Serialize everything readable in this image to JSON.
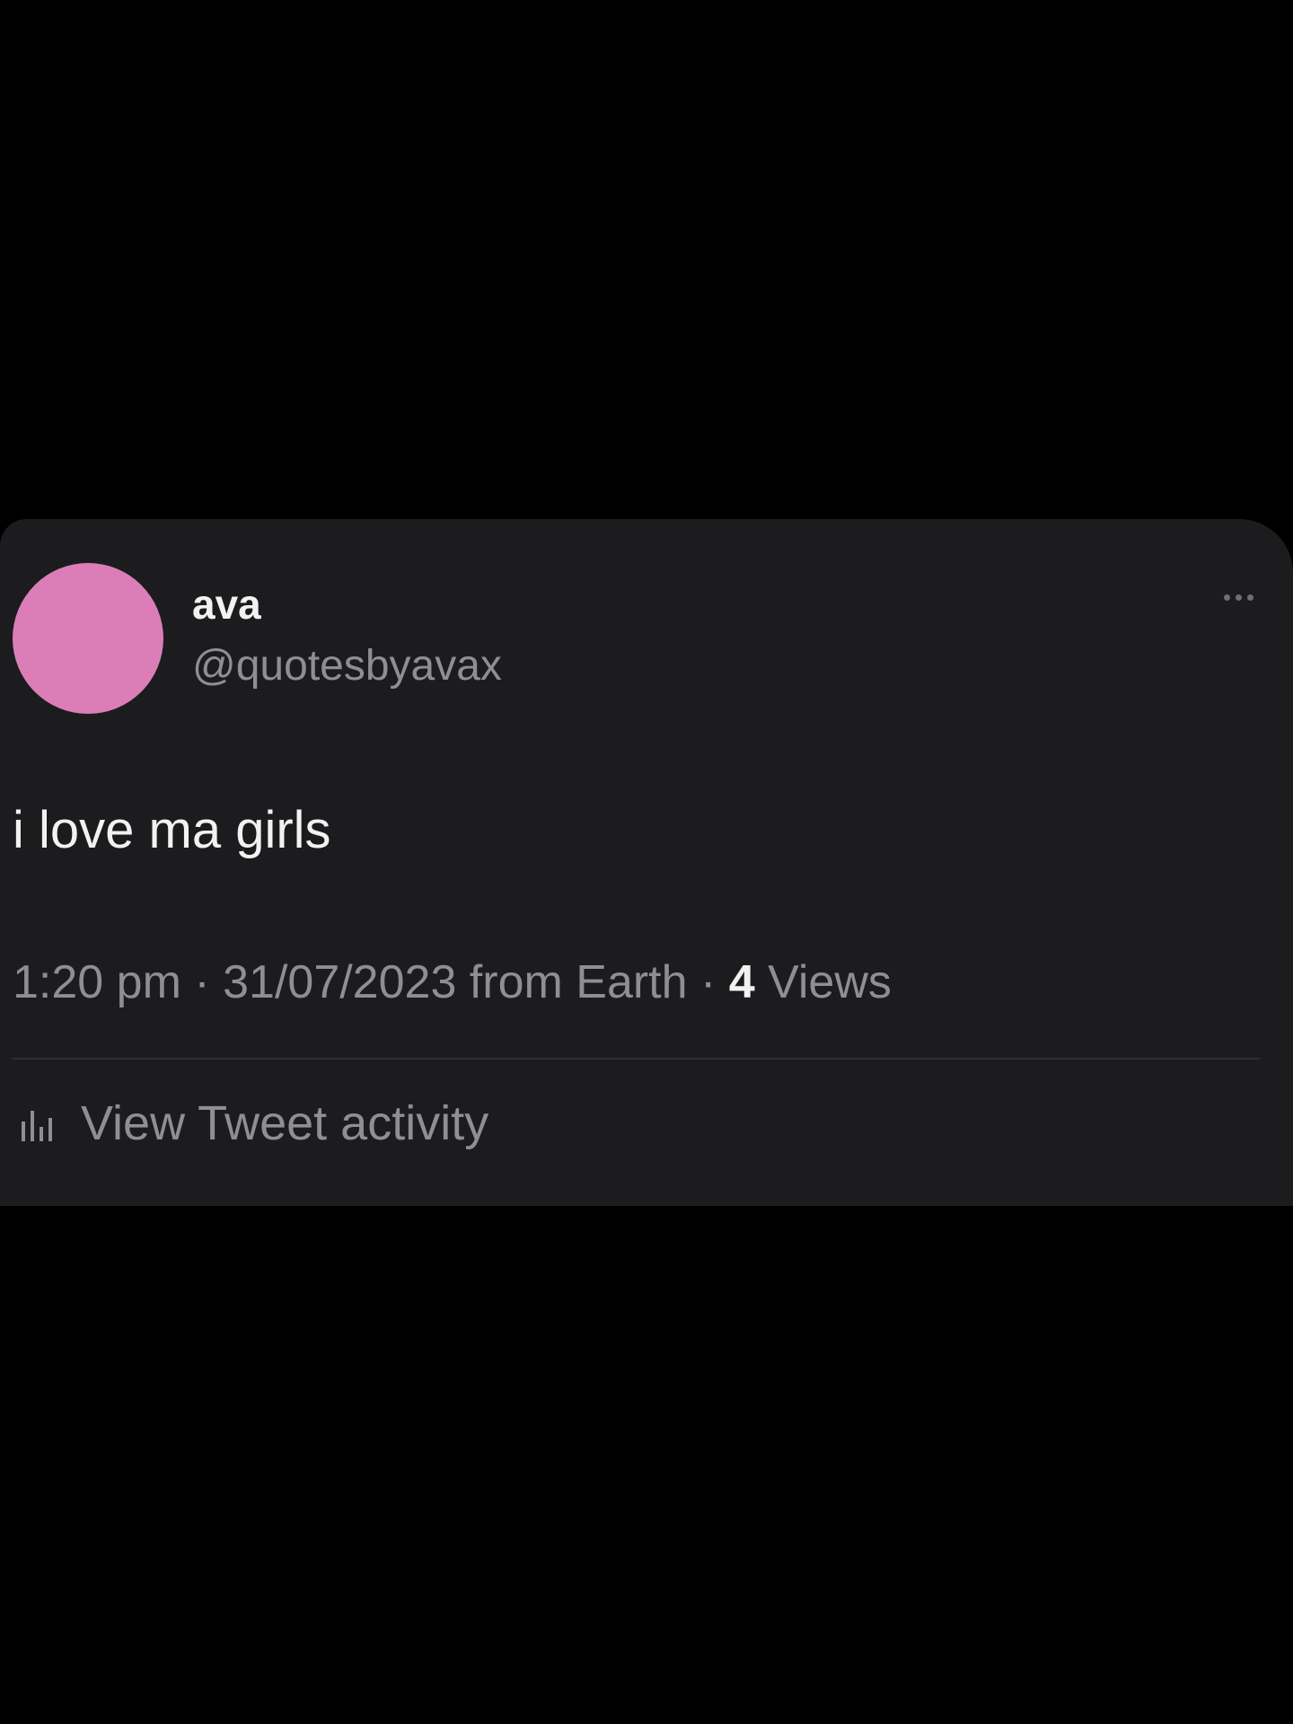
{
  "tweet": {
    "author": {
      "display_name": "ava",
      "handle": "@quotesbyavax",
      "avatar_color": "#db7eb8"
    },
    "more_icon": "more-options-icon",
    "text": "i love ma girls",
    "meta": {
      "time": "1:20 pm",
      "separator1": " · ",
      "date_source": "31/07/2023 from Earth",
      "separator2": " · ",
      "views_count": "4",
      "views_label": " Views"
    },
    "activity": {
      "icon": "bar-chart-icon",
      "label": "View Tweet activity"
    }
  },
  "colors": {
    "background": "#000000",
    "card": "#1c1c1e",
    "primary_text": "#f2f2f2",
    "secondary_text": "#8e8e93",
    "divider": "#2f2f33"
  }
}
